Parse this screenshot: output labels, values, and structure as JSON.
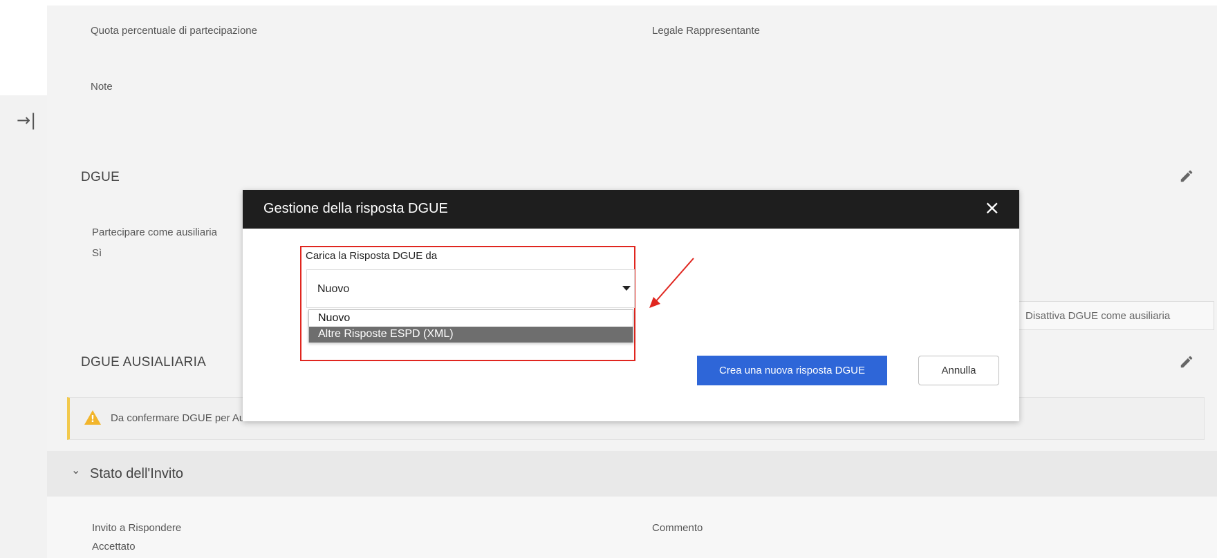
{
  "top_fields": {
    "quota_label": "Quota percentuale di partecipazione",
    "legale_label": "Legale Rappresentante",
    "note_label": "Note"
  },
  "sidebar": {
    "collapse_icon": "→|"
  },
  "dgue_section": {
    "title": "DGUE",
    "partecipare_label": "Partecipare come ausiliaria",
    "partecipare_value": "Sì",
    "disattiva_button": "Disattiva DGUE come ausiliaria"
  },
  "dgue_ausiliaria_section": {
    "title": "DGUE AUSIALIARIA",
    "warning_text": "Da confermare DGUE per Ausiliaria"
  },
  "stato_section": {
    "title": "Stato dell'Invito",
    "invito_label": "Invito a Rispondere",
    "invito_value": "Accettato",
    "commento_label": "Commento"
  },
  "modal": {
    "title": "Gestione della risposta DGUE",
    "close_icon": "×",
    "carica_label": "Carica la Risposta DGUE da",
    "select_value": "Nuovo",
    "options": [
      "Nuovo",
      "Altre Risposte ESPD (XML)"
    ],
    "primary_button": "Crea una nuova risposta DGUE",
    "secondary_button": "Annulla"
  },
  "colors": {
    "primary": "#2e66d8",
    "highlight": "#e0261f",
    "modal_header": "#1e1e1e",
    "warning": "#f2b52b"
  }
}
